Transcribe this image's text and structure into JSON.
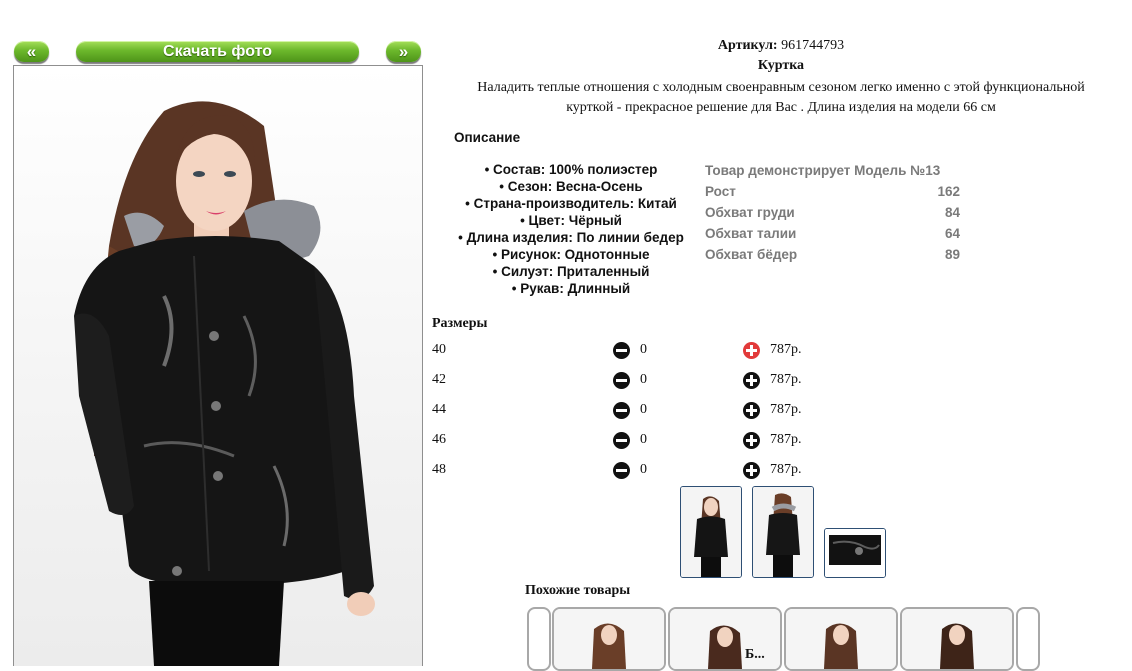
{
  "nav": {
    "prev_label": "«",
    "download_label": "Скачать фото",
    "next_label": "»"
  },
  "product": {
    "article_label": "Артикул:",
    "article_value": "961744793",
    "name": "Куртка",
    "desc_line1": "Наладить теплые отношения с холодным своенравным сезоном легко именно с этой функциональной",
    "desc_line2": "курткой - прекрасное решение для Вас . Длина изделия на модели 66 см"
  },
  "description": {
    "heading": "Описание",
    "items": [
      "• Состав: 100% полиэстер",
      "• Сезон: Весна-Осень",
      "• Страна-производитель: Китай",
      "• Цвет: Чёрный",
      "• Длина изделия: По линии бедер",
      "• Рисунок: Однотонные",
      "• Силуэт: Приталенный",
      "• Рукав: Длинный"
    ]
  },
  "model": {
    "title": "Товар демонстрирует Модель №13",
    "rows": [
      {
        "label": "Рост",
        "value": "162"
      },
      {
        "label": "Обхват груди",
        "value": "84"
      },
      {
        "label": "Обхват талии",
        "value": "64"
      },
      {
        "label": "Обхват бёдер",
        "value": "89"
      }
    ]
  },
  "sizes": {
    "heading": "Размеры",
    "rows": [
      {
        "size": "40",
        "qty": "0",
        "price": "787р."
      },
      {
        "size": "42",
        "qty": "0",
        "price": "787р."
      },
      {
        "size": "44",
        "qty": "0",
        "price": "787р."
      },
      {
        "size": "46",
        "qty": "0",
        "price": "787р."
      },
      {
        "size": "48",
        "qty": "0",
        "price": "787р."
      }
    ]
  },
  "similar": {
    "heading": "Похожие товары",
    "cut_text": "Б..."
  },
  "colors": {
    "accent_green": "#6cb82c",
    "plus_highlight": "#e23a3a",
    "thumb_border": "#2e4f74"
  },
  "icons": {
    "minus": "minus-circle-icon",
    "plus": "plus-circle-icon"
  }
}
